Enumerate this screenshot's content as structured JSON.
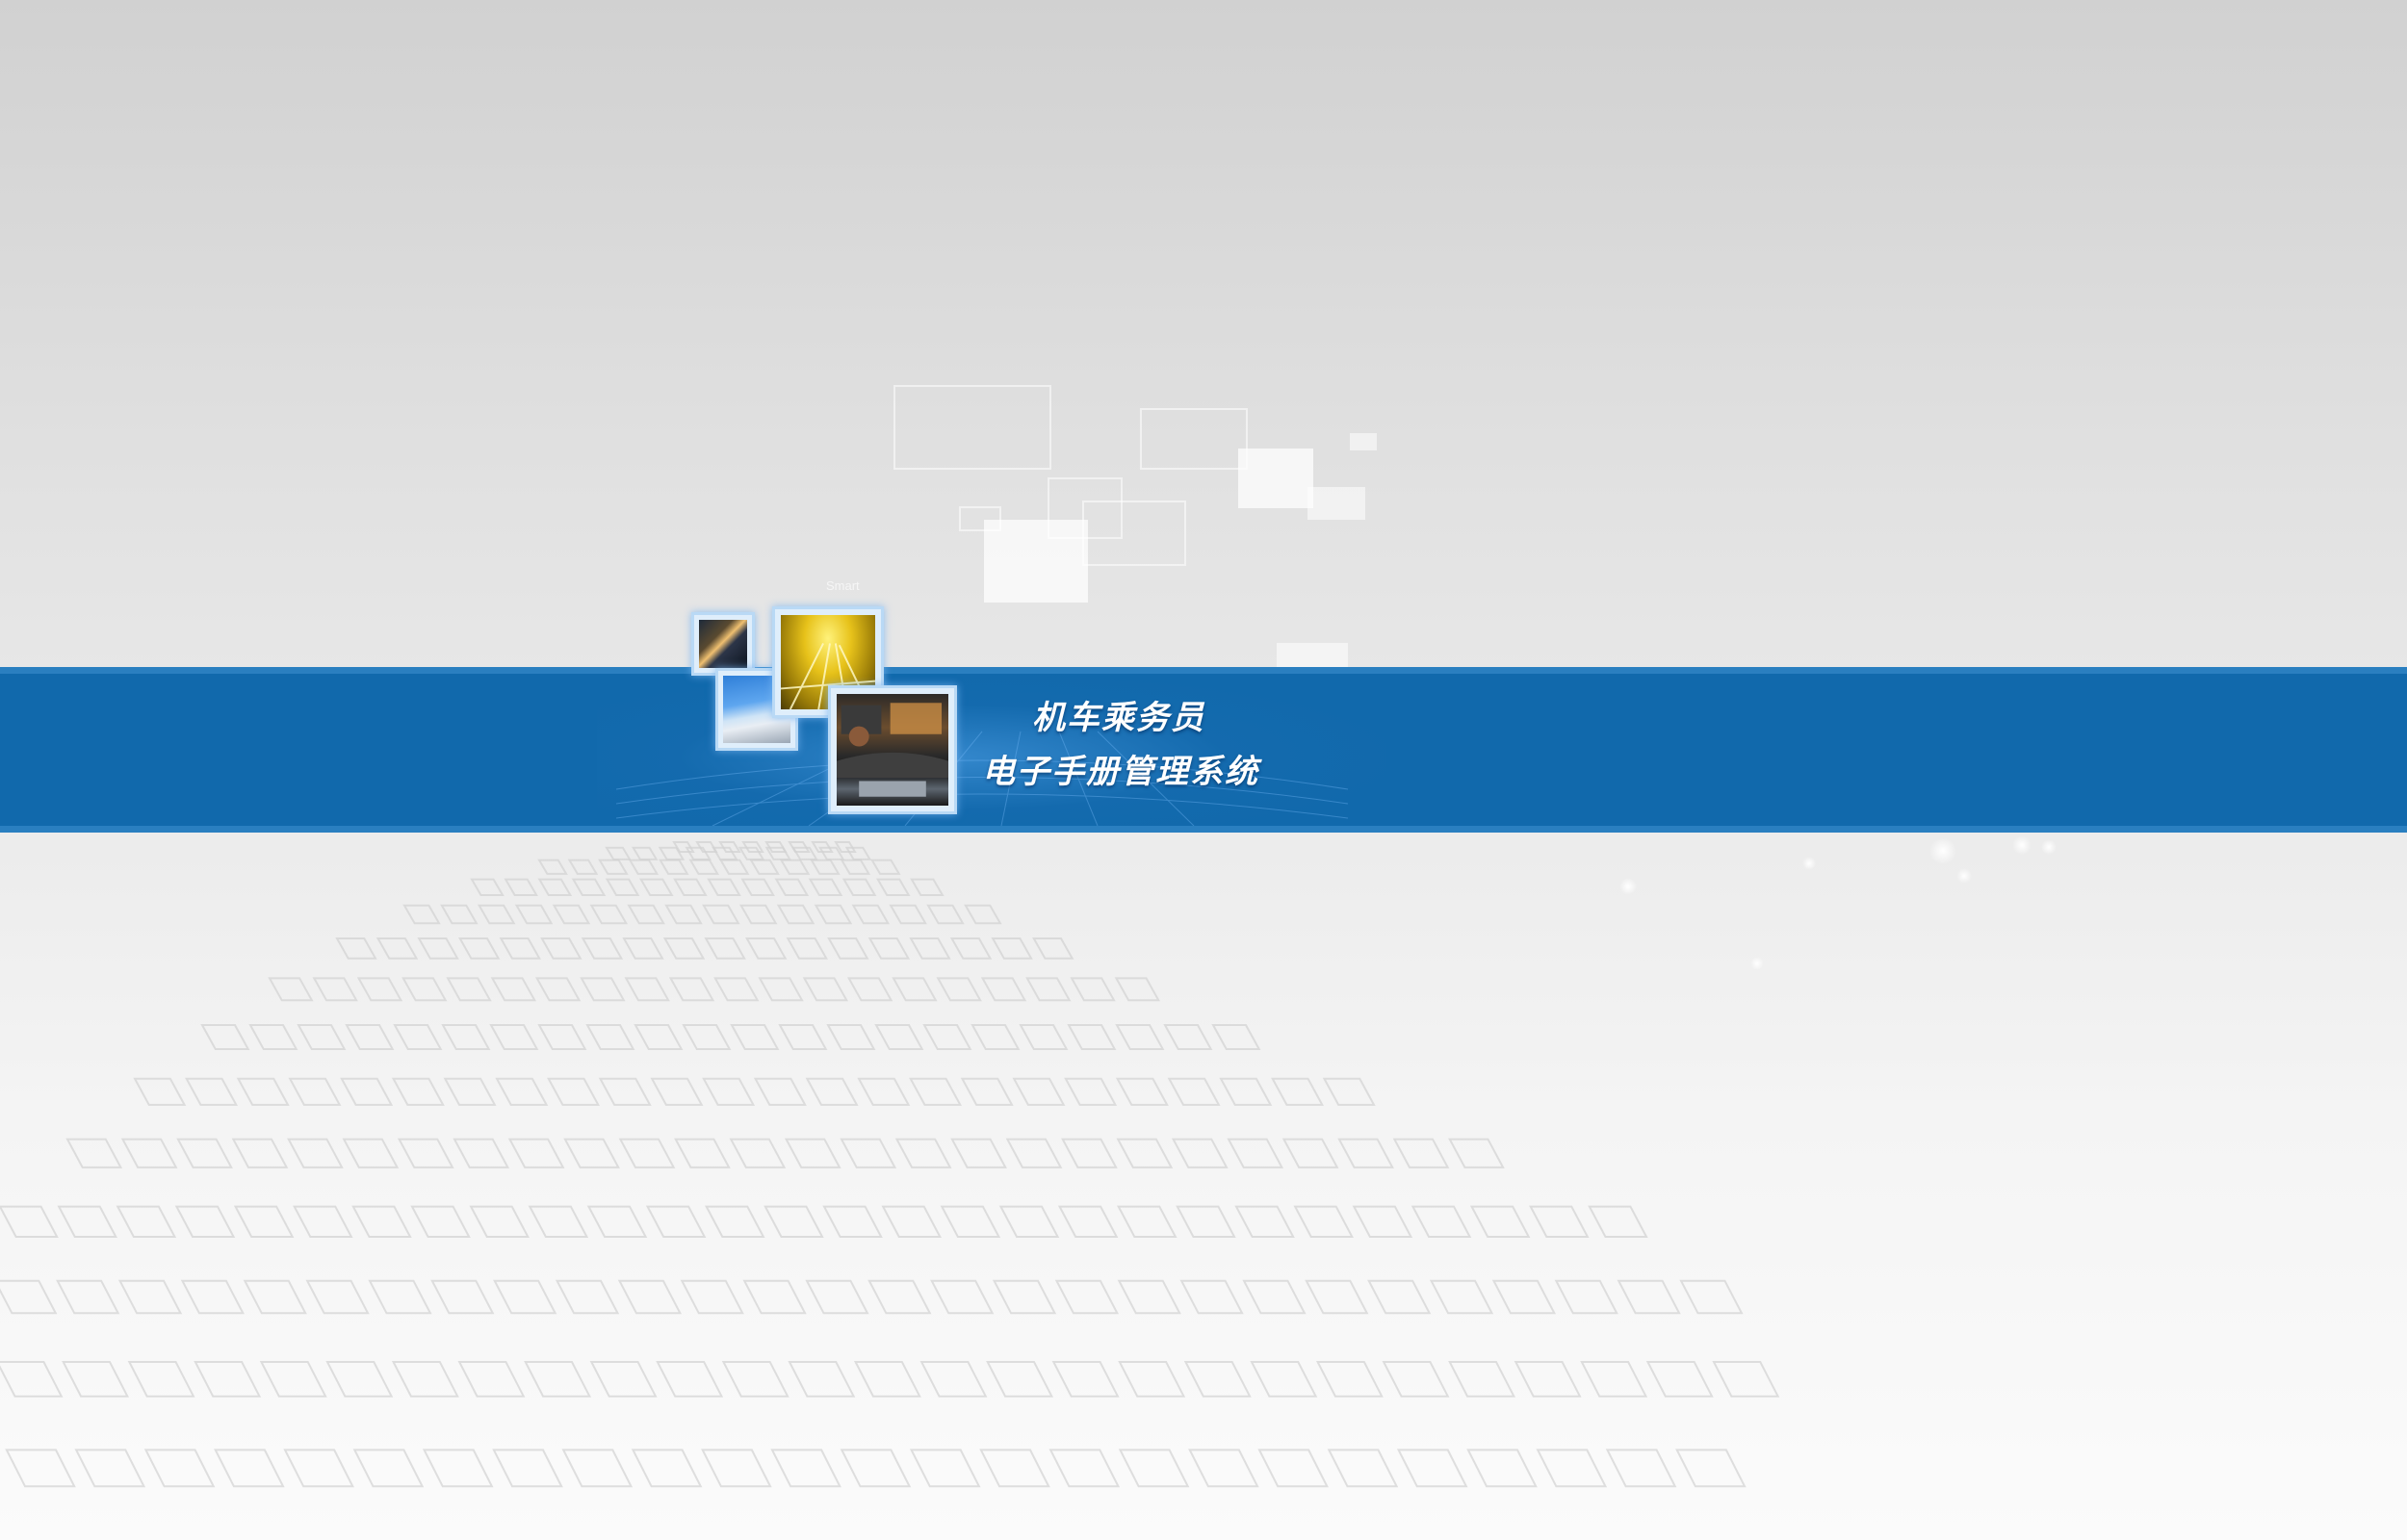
{
  "banner": {
    "title_line1": "机车乘务员",
    "title_line2": "电子手册管理系统",
    "small_word": "Smart"
  },
  "colors": {
    "band": "#1169ac",
    "band_border": "#2a7fc0",
    "background_top": "#d1d1d1",
    "background_bottom": "#fbfbfb",
    "title_text": "#ffffff"
  },
  "thumbnails": [
    {
      "name": "tunnel-motion-photo"
    },
    {
      "name": "high-speed-train-photo"
    },
    {
      "name": "rail-tracks-night-photo"
    },
    {
      "name": "cab-driver-photo"
    }
  ]
}
